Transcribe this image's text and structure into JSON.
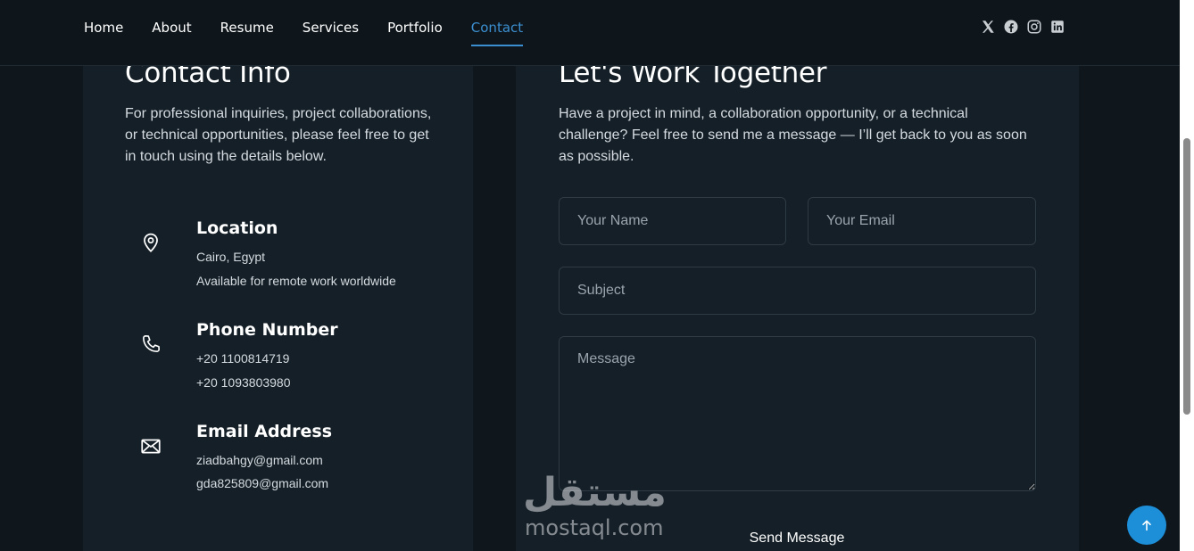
{
  "nav": {
    "links": [
      "Home",
      "About",
      "Resume",
      "Services",
      "Portfolio",
      "Contact"
    ],
    "active": "Contact",
    "socials": [
      "x-icon",
      "facebook-icon",
      "instagram-icon",
      "linkedin-icon"
    ]
  },
  "contact_info": {
    "heading": "Contact Info",
    "intro": "For professional inquiries, project collaborations, or technical opportunities, please feel free to get in touch using the details below.",
    "items": [
      {
        "title": "Location",
        "lines": [
          "Cairo, Egypt",
          "Available for remote work worldwide"
        ],
        "icon": "location-pin-icon"
      },
      {
        "title": "Phone Number",
        "lines": [
          "+20 1100814719",
          "+20 1093803980"
        ],
        "icon": "phone-icon"
      },
      {
        "title": "Email Address",
        "lines": [
          "ziadbahgy@gmail.com",
          "gda825809@gmail.com"
        ],
        "icon": "envelope-icon"
      }
    ]
  },
  "form": {
    "heading": "Let's Work Together",
    "intro": "Have a project in mind, a collaboration opportunity, or a technical challenge? Feel free to send me a message — I’ll get back to you as soon as possible.",
    "name_placeholder": "Your Name",
    "email_placeholder": "Your Email",
    "subject_placeholder": "Subject",
    "message_placeholder": "Message",
    "submit_label": "Send Message"
  },
  "watermark": {
    "arabic": "مستقل",
    "latin": "mostaql.com"
  },
  "colors": {
    "accent": "#3b8fd0",
    "background": "#0f171d",
    "card": "#141f27",
    "scroll_button": "#1d8ed8"
  }
}
